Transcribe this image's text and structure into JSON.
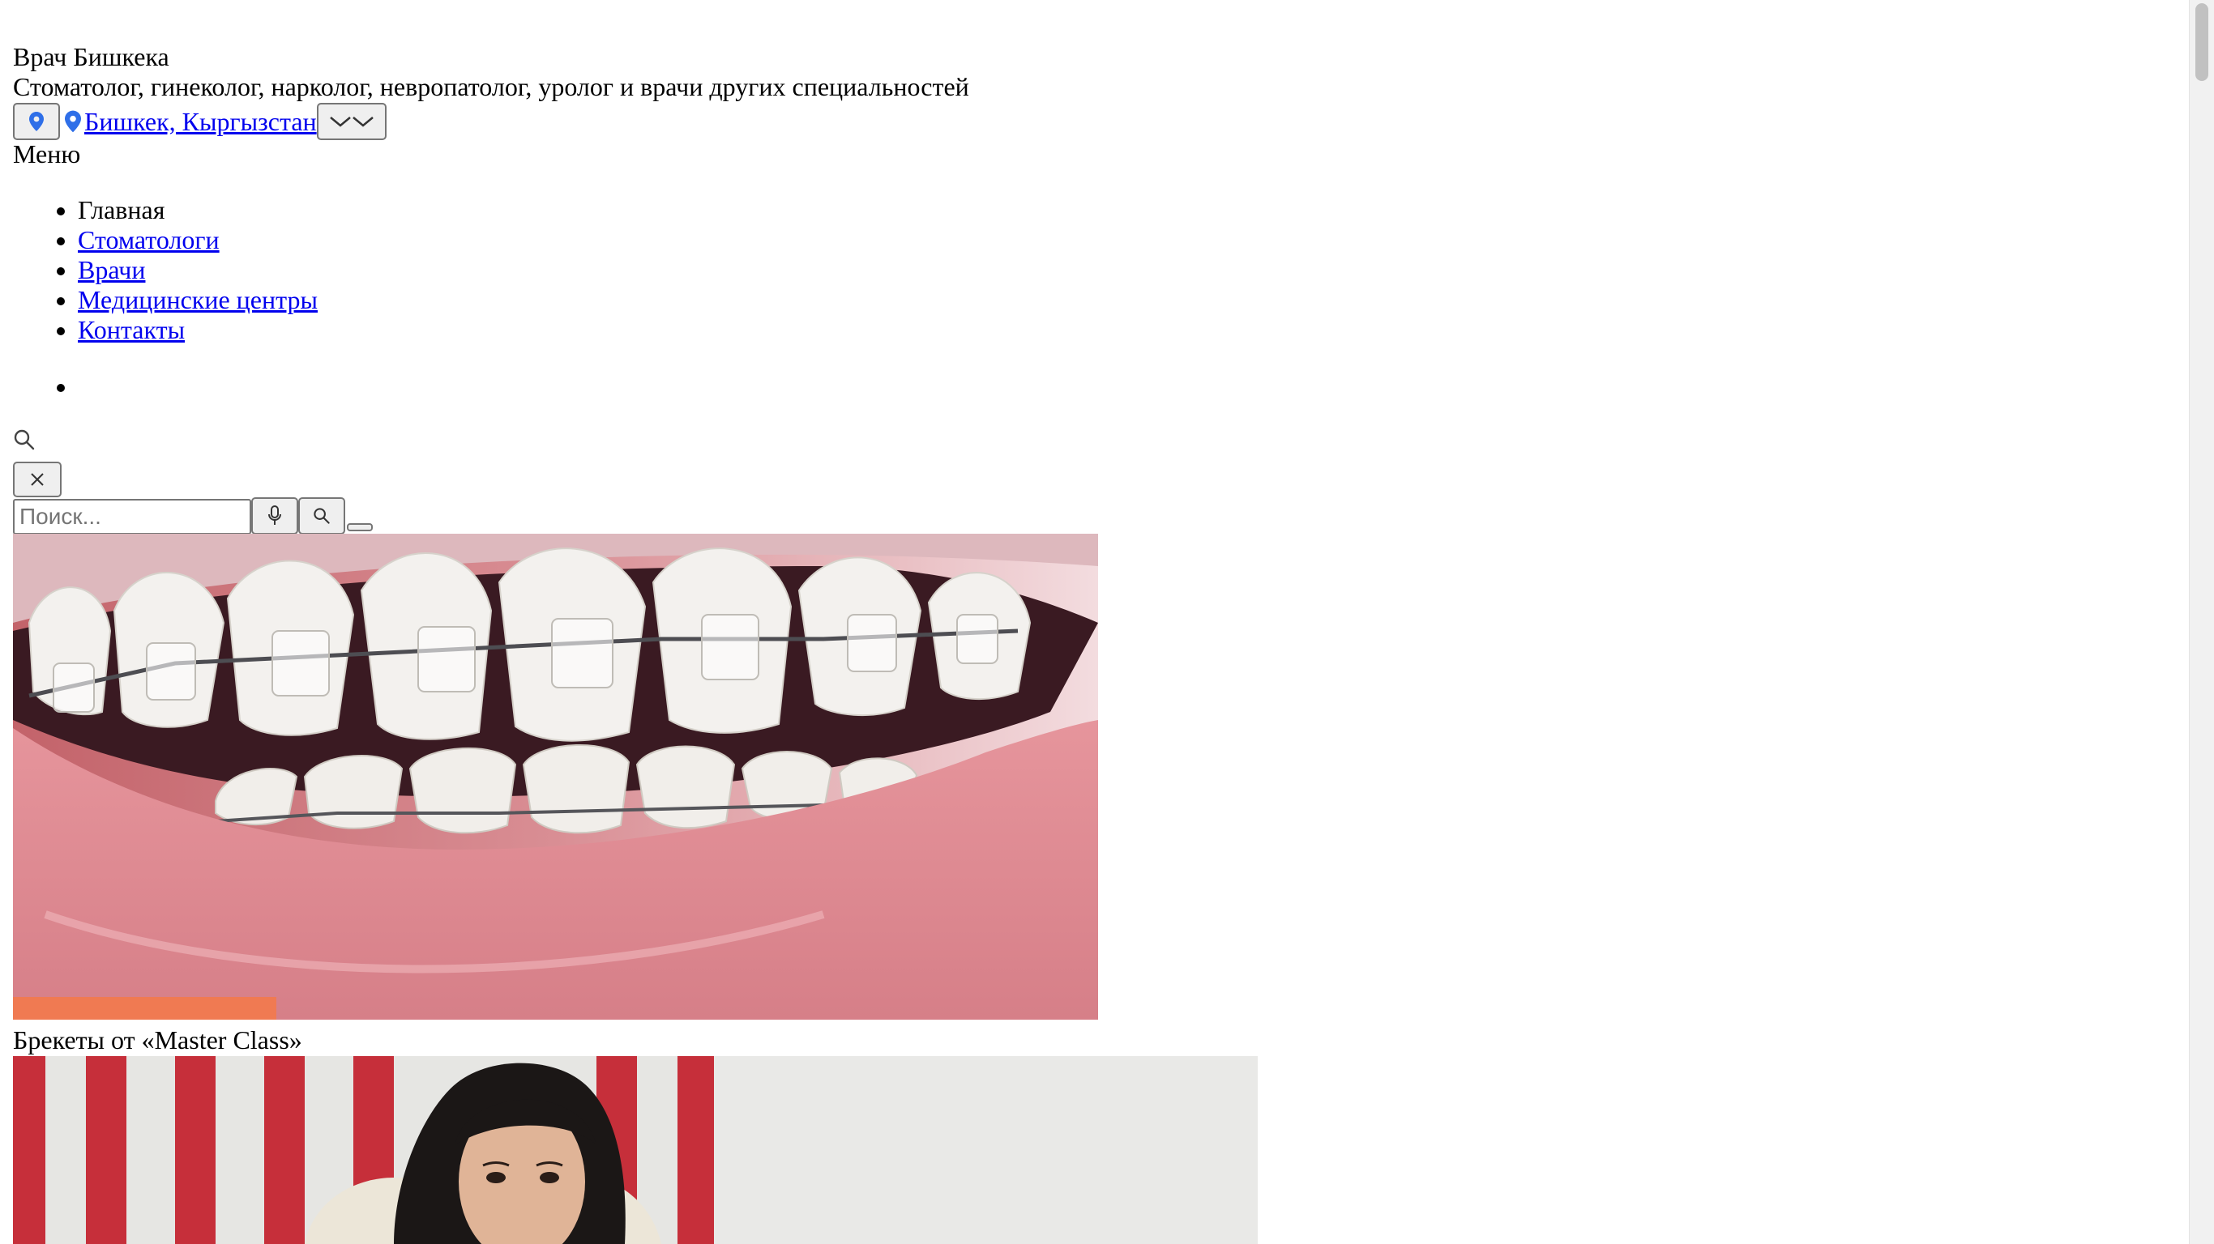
{
  "header": {
    "site_title": "Врач Бишкека",
    "site_description": "Стоматолог, гинеколог, нарколог, невропатолог, уролог и врачи других специальностей",
    "location_link": "Бишкек, Кыргызстан"
  },
  "menu": {
    "label": "Меню",
    "items": [
      {
        "label": "Главная",
        "current": true
      },
      {
        "label": "Стоматологи"
      },
      {
        "label": "Врачи"
      },
      {
        "label": "Медицинские центры"
      },
      {
        "label": "Контакты"
      }
    ]
  },
  "search": {
    "placeholder": "Поиск..."
  },
  "posts": [
    {
      "title": "Брекеты от «Master Class»",
      "accent_color": "#f07a52"
    }
  ],
  "colors": {
    "link": "#0000ee",
    "pin": "#2f6fe8",
    "accent": "#f07a52"
  },
  "icons": [
    "map-pin-icon",
    "chevron-down-icon",
    "search-icon",
    "close-icon",
    "microphone-icon"
  ]
}
